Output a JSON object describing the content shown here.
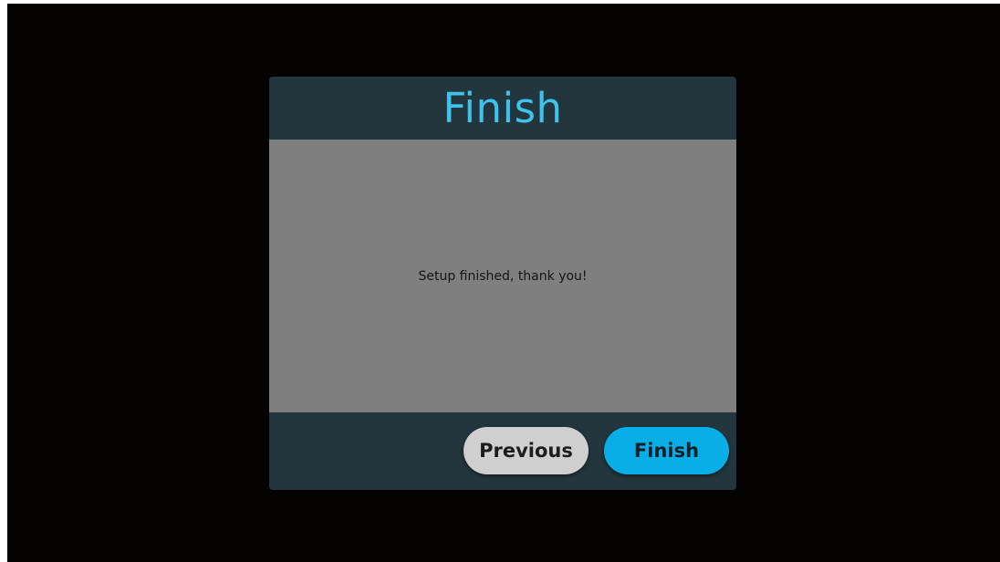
{
  "dialog": {
    "title": "Finish",
    "message": "Setup finished, thank you!",
    "buttons": {
      "previous_label": "Previous",
      "finish_label": "Finish"
    }
  },
  "colors": {
    "background": "#050202",
    "dialog_chrome": "#23363d",
    "dialog_body": "#807f7f",
    "title_accent": "#3ec3ec",
    "primary_button": "#0aaee7",
    "secondary_button": "#cfcfcf"
  }
}
